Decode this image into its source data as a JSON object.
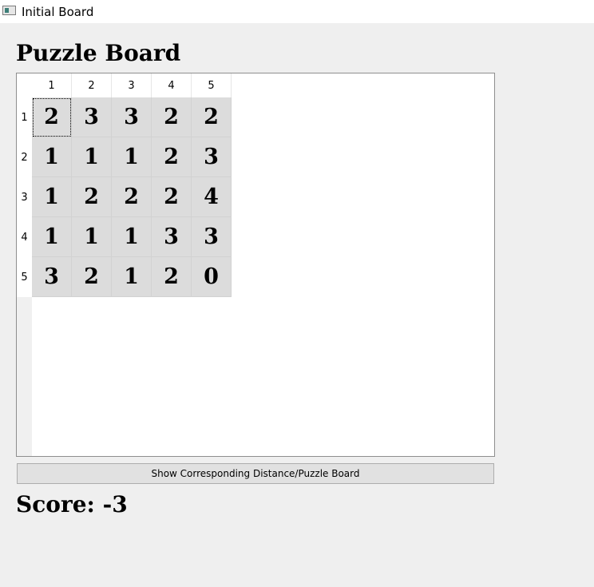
{
  "window": {
    "title": "Initial Board",
    "icon": "window-app-icon"
  },
  "board": {
    "title": "Puzzle Board",
    "column_headers": [
      "1",
      "2",
      "3",
      "4",
      "5"
    ],
    "row_headers": [
      "1",
      "2",
      "3",
      "4",
      "5"
    ],
    "rows": [
      [
        "2",
        "3",
        "3",
        "2",
        "2"
      ],
      [
        "1",
        "1",
        "1",
        "2",
        "3"
      ],
      [
        "1",
        "2",
        "2",
        "2",
        "4"
      ],
      [
        "1",
        "1",
        "1",
        "3",
        "3"
      ],
      [
        "3",
        "2",
        "1",
        "2",
        "0"
      ]
    ],
    "current_cell": {
      "row": 1,
      "column": 1
    }
  },
  "toggle_button": {
    "label": "Show Corresponding Distance/Puzzle Board"
  },
  "score": {
    "text": "Score: -3"
  }
}
